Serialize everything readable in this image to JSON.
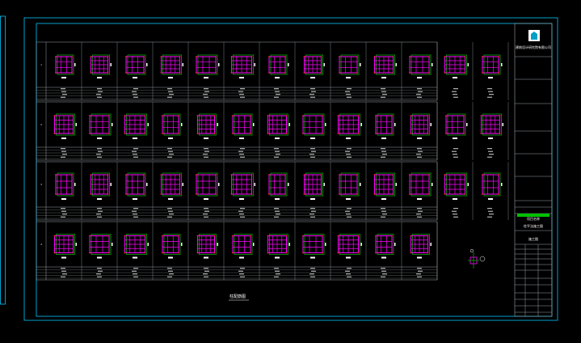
{
  "colors": {
    "background": "#000000",
    "frame": "#00c8ff",
    "grid_line": "#9aa0a6",
    "column_outline": "#00e000",
    "rebar": "#ff00ff",
    "rebar_dot": "#ff3030",
    "text": "#e6e6e6",
    "title_accent": "#00c000"
  },
  "drawing": {
    "caption": "柱配筋图",
    "title_block": {
      "logo_icon": "building-logo-icon",
      "company": "建筑设计研究院有限公司",
      "project": "项目名称",
      "drawing_name": "柱平法施工图",
      "stage": "施工图"
    }
  },
  "rows": [
    {
      "label": "1",
      "count": 13
    },
    {
      "label": "2",
      "count": 13
    },
    {
      "label": "3",
      "count": 13
    },
    {
      "label": "4",
      "count": 11
    }
  ],
  "legend": {
    "icon": "column-section-legend-icon"
  }
}
